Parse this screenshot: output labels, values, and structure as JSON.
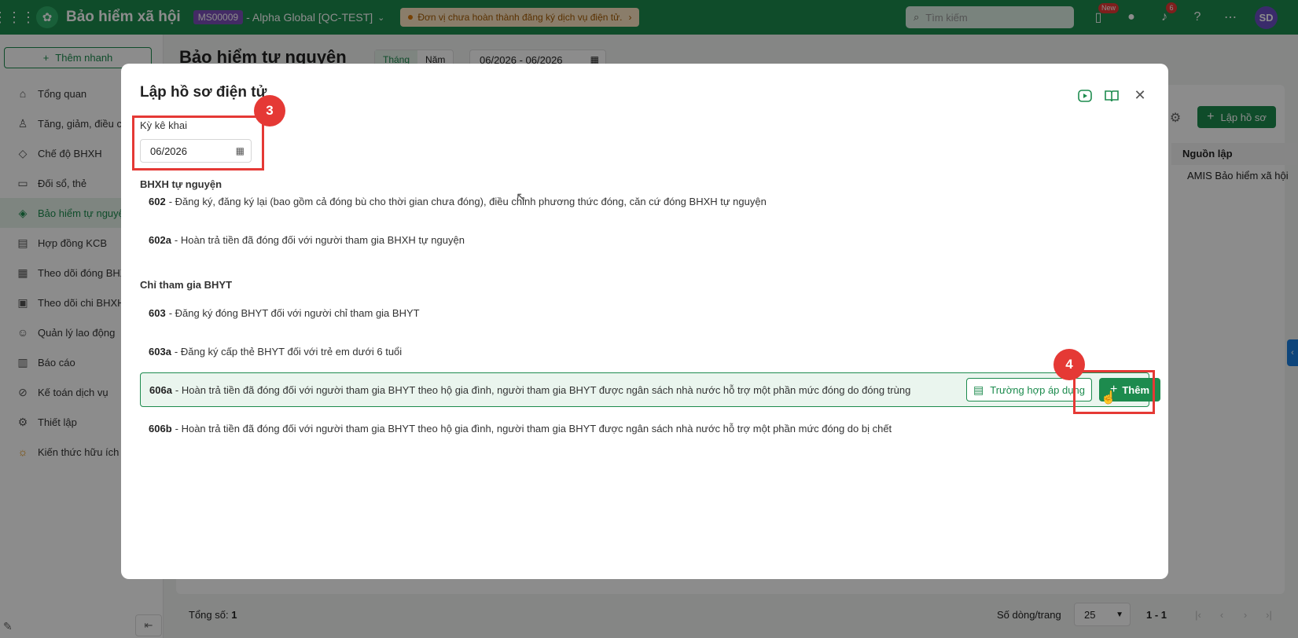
{
  "topbar": {
    "app_title": "Bảo hiểm xã hội",
    "org_code": "MS00009",
    "org_name": "- Alpha Global [QC-TEST]",
    "warning": "Đơn vị chưa hoàn thành đăng ký dịch vụ điện tử.",
    "search_placeholder": "Tìm kiếm",
    "new_badge": "New",
    "notification_count": "6",
    "avatar_initials": "SD"
  },
  "sidebar": {
    "quick_add": "Thêm nhanh",
    "items": [
      {
        "label": "Tổng quan",
        "icon": "home-icon"
      },
      {
        "label": "Tăng, giảm, điều chỉnh",
        "icon": "user-arrow-icon"
      },
      {
        "label": "Chế độ BHXH",
        "icon": "shield-icon"
      },
      {
        "label": "Đối sổ, thẻ",
        "icon": "book-icon"
      },
      {
        "label": "Bảo hiểm tự nguyện",
        "icon": "shield-check-icon"
      },
      {
        "label": "Hợp đồng KCB",
        "icon": "document-icon"
      },
      {
        "label": "Theo dõi đóng BHXH",
        "icon": "calendar-icon"
      },
      {
        "label": "Theo dõi chi BHXH",
        "icon": "money-icon"
      },
      {
        "label": "Quản lý lao động",
        "icon": "users-icon"
      },
      {
        "label": "Báo cáo",
        "icon": "report-icon"
      },
      {
        "label": "Kế toán dịch vụ",
        "icon": "calculator-icon"
      },
      {
        "label": "Thiết lập",
        "icon": "gear-icon"
      },
      {
        "label": "Kiến thức hữu ích",
        "icon": "knowledge-icon"
      }
    ]
  },
  "main": {
    "title": "Bảo hiểm tự nguyện",
    "period_tabs": [
      "Tháng",
      "Năm"
    ],
    "date_range": "06/2026 - 06/2026",
    "create_button": "Lập hồ sơ",
    "column_header": "Nguồn lập",
    "cell_value": "AMIS Bảo hiểm xã hội",
    "total_label": "Tổng số:",
    "total_value": "1",
    "rows_per_page_label": "Số dòng/trang",
    "rows_per_page": "25",
    "pager_text": "1 - 1"
  },
  "modal": {
    "title": "Lập hồ sơ điện tử",
    "period_label": "Kỳ kê khai",
    "period_value": "06/2026",
    "groups": [
      {
        "title": "BHXH tự nguyện",
        "forms": [
          {
            "code": "602",
            "text": "- Đăng ký, đăng ký lại (bao gồm cả đóng bù cho thời gian chưa đóng), điều chỉnh phương thức đóng, căn cứ đóng BHXH tự nguyện"
          },
          {
            "code": "602a",
            "text": "- Hoàn trả tiền đã đóng đối với người tham gia BHXH tự nguyện"
          }
        ]
      },
      {
        "title": "Chỉ tham gia BHYT",
        "forms": [
          {
            "code": "603",
            "text": "- Đăng ký đóng BHYT đối với người chỉ tham gia BHYT"
          },
          {
            "code": "603a",
            "text": "- Đăng ký cấp thẻ BHYT đối với trẻ em dưới 6 tuổi"
          },
          {
            "code": "606a",
            "text": "- Hoàn trả tiền đã đóng đối với người tham gia BHYT theo hộ gia đình, người tham gia BHYT được ngân sách nhà nước hỗ trợ một phần mức đóng do đóng trùng"
          },
          {
            "code": "606b",
            "text": "- Hoàn trả tiền đã đóng đối với người tham gia BHYT theo hộ gia đình, người tham gia BHYT được ngân sách nhà nước hỗ trợ một phần mức đóng do bị chết"
          }
        ]
      }
    ],
    "case_button": "Trường hợp áp dụng",
    "add_button": "Thêm",
    "step_3": "3",
    "step_4": "4"
  },
  "colors": {
    "brand": "#1d8b4e",
    "highlight": "#e53935"
  }
}
